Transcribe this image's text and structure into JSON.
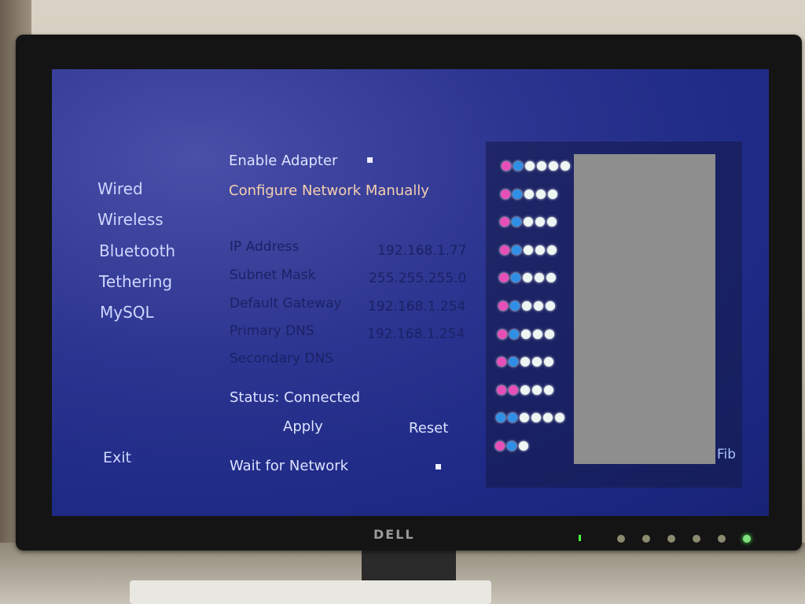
{
  "nav": {
    "items": [
      "Wired",
      "Wireless",
      "Bluetooth",
      "Tethering",
      "MySQL"
    ],
    "exit": "Exit"
  },
  "settings": {
    "enable_adapter": "Enable Adapter",
    "enable_adapter_checked": true,
    "configure_manually": "Configure Network Manually",
    "fields": [
      {
        "label": "IP Address",
        "value": "192.168.1.77"
      },
      {
        "label": "Subnet Mask",
        "value": "255.255.255.0"
      },
      {
        "label": "Default Gateway",
        "value": "192.168.1.254"
      },
      {
        "label": "Primary DNS",
        "value": "192.168.1.254"
      },
      {
        "label": "Secondary DNS",
        "value": ""
      }
    ],
    "status": "Status: Connected",
    "apply": "Apply",
    "reset": "Reset",
    "wait_for_network": "Wait for Network",
    "wait_for_network_checked": true
  },
  "side_panel": {
    "rows": [
      [
        "pink",
        "blue",
        "white",
        "white",
        "white",
        "white"
      ],
      [
        "pink",
        "blue",
        "white",
        "white",
        "white"
      ],
      [
        "pink",
        "blue",
        "white",
        "white",
        "white"
      ],
      [
        "pink",
        "blue",
        "white",
        "white",
        "white"
      ],
      [
        "pink",
        "blue",
        "white",
        "white",
        "white"
      ],
      [
        "pink",
        "blue",
        "white",
        "white",
        "white"
      ],
      [
        "pink",
        "blue",
        "white",
        "white",
        "white"
      ],
      [
        "pink",
        "blue",
        "white",
        "white",
        "white"
      ],
      [
        "pink",
        "pink",
        "white",
        "white",
        "white"
      ],
      [
        "blue",
        "blue",
        "white",
        "white",
        "white",
        "white"
      ],
      [
        "pink",
        "blue",
        "white"
      ]
    ],
    "label": "Fib"
  },
  "monitor": {
    "brand": "DELL"
  },
  "colors": {
    "background": "#1e2a86",
    "accent_orange": "#f6d0b0",
    "pink": "#e64fb8",
    "blue": "#2f8fe6"
  }
}
